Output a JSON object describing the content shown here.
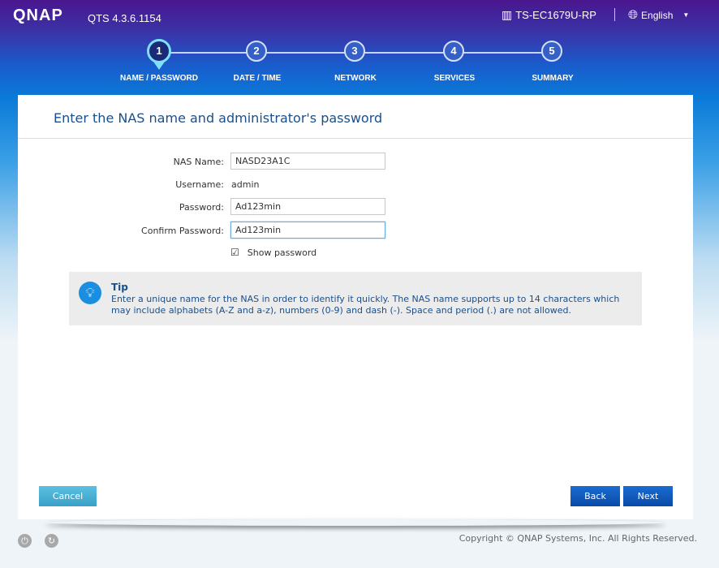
{
  "header": {
    "logo": "QNAP",
    "version": "QTS 4.3.6.1154",
    "model": "TS-EC1679U-RP",
    "language": "English"
  },
  "steps": [
    {
      "num": "1",
      "label": "NAME / PASSWORD",
      "active": true
    },
    {
      "num": "2",
      "label": "DATE / TIME"
    },
    {
      "num": "3",
      "label": "NETWORK"
    },
    {
      "num": "4",
      "label": "SERVICES"
    },
    {
      "num": "5",
      "label": "SUMMARY"
    }
  ],
  "form": {
    "title": "Enter the NAS name and administrator's password",
    "nas_name_label": "NAS Name:",
    "nas_name_value": "NASD23A1C",
    "username_label": "Username:",
    "username_value": "admin",
    "password_label": "Password:",
    "password_value": "Ad123min",
    "confirm_label": "Confirm Password:",
    "confirm_value": "Ad123min",
    "show_password_label": "Show password",
    "show_password_checked": true
  },
  "tip": {
    "title": "Tip",
    "text": "Enter a unique name for the NAS in order to identify it quickly. The NAS name supports up to 14 characters which may include alphabets (A-Z and a-z), numbers (0-9) and dash (-). Space and period (.) are not allowed."
  },
  "buttons": {
    "cancel": "Cancel",
    "back": "Back",
    "next": "Next"
  },
  "footer": {
    "copyright": "Copyright © QNAP Systems, Inc. All Rights Reserved."
  }
}
